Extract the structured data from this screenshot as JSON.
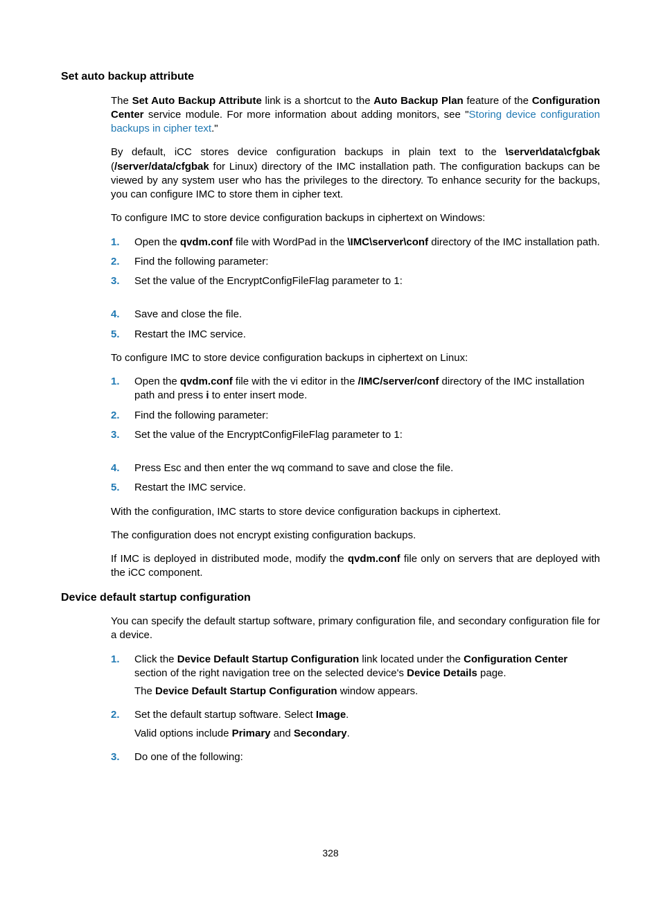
{
  "section1": {
    "heading": "Set auto backup attribute",
    "p1_a": "The ",
    "p1_b": "Set Auto Backup Attribute",
    "p1_c": " link is a shortcut to the ",
    "p1_d": "Auto Backup Plan",
    "p1_e": " feature of the ",
    "p1_f": "Configuration Center",
    "p1_g": " service module. For more information about adding monitors, see \"",
    "p1_link": "Storing device configuration backups in cipher text",
    "p1_h": ".\"",
    "p2_a": "By default, iCC stores device configuration backups in plain text to the ",
    "p2_b": "\\server\\data\\cfgbak",
    "p2_c": " (",
    "p2_d": "/server/data/cfgbak",
    "p2_e": " for Linux) directory of the IMC installation path. The configuration backups can be viewed by any system user who has the privileges to the directory. To enhance security for the backups, you can configure IMC to store them in cipher text.",
    "p3": "To configure IMC to store device configuration backups in ciphertext on Windows:",
    "win": {
      "s1_a": "Open the ",
      "s1_b": "qvdm.conf",
      "s1_c": " file with WordPad in the ",
      "s1_d": "\\IMC\\server\\conf",
      "s1_e": " directory of the IMC installation path.",
      "s2": "Find the following parameter:",
      "s3": "Set the value of the EncryptConfigFileFlag parameter to 1:",
      "s4": "Save and close the file.",
      "s5": "Restart the IMC service."
    },
    "p4": "To configure IMC to store device configuration backups in ciphertext on Linux:",
    "lin": {
      "s1_a": "Open the ",
      "s1_b": "qvdm.conf",
      "s1_c": " file with the vi editor in the ",
      "s1_d": "/IMC/server/conf",
      "s1_e": " directory of the IMC installation path and press ",
      "s1_f": "i",
      "s1_g": " to enter insert mode.",
      "s2": "Find the following parameter:",
      "s3": "Set the value of the EncryptConfigFileFlag parameter to 1:",
      "s4": "Press Esc and then enter the wq command to save and close the file.",
      "s5": "Restart the IMC service."
    },
    "p5": "With the configuration, IMC starts to store device configuration backups in ciphertext.",
    "p6": "The configuration does not encrypt existing configuration backups.",
    "p7_a": "If IMC is deployed in distributed mode, modify the ",
    "p7_b": "qvdm.conf",
    "p7_c": " file only on servers that are deployed with the iCC component."
  },
  "section2": {
    "heading": "Device default startup configuration",
    "p1": "You can specify the default startup software, primary configuration file, and secondary configuration file for a device.",
    "s1_a": "Click the ",
    "s1_b": "Device Default Startup Configuration",
    "s1_c": " link located under the ",
    "s1_d": "Configuration Center",
    "s1_e": " section of the right navigation tree on the selected device's ",
    "s1_f": "Device Details",
    "s1_g": " page.",
    "s1_sub_a": "The ",
    "s1_sub_b": "Device Default Startup Configuration",
    "s1_sub_c": " window appears.",
    "s2_a": "Set the default startup software. Select ",
    "s2_b": "Image",
    "s2_c": ".",
    "s2_sub_a": "Valid options include ",
    "s2_sub_b": "Primary",
    "s2_sub_c": " and ",
    "s2_sub_d": "Secondary",
    "s2_sub_e": ".",
    "s3": "Do one of the following:"
  },
  "nums": {
    "n1": "1.",
    "n2": "2.",
    "n3": "3.",
    "n4": "4.",
    "n5": "5."
  },
  "pagenum": "328"
}
